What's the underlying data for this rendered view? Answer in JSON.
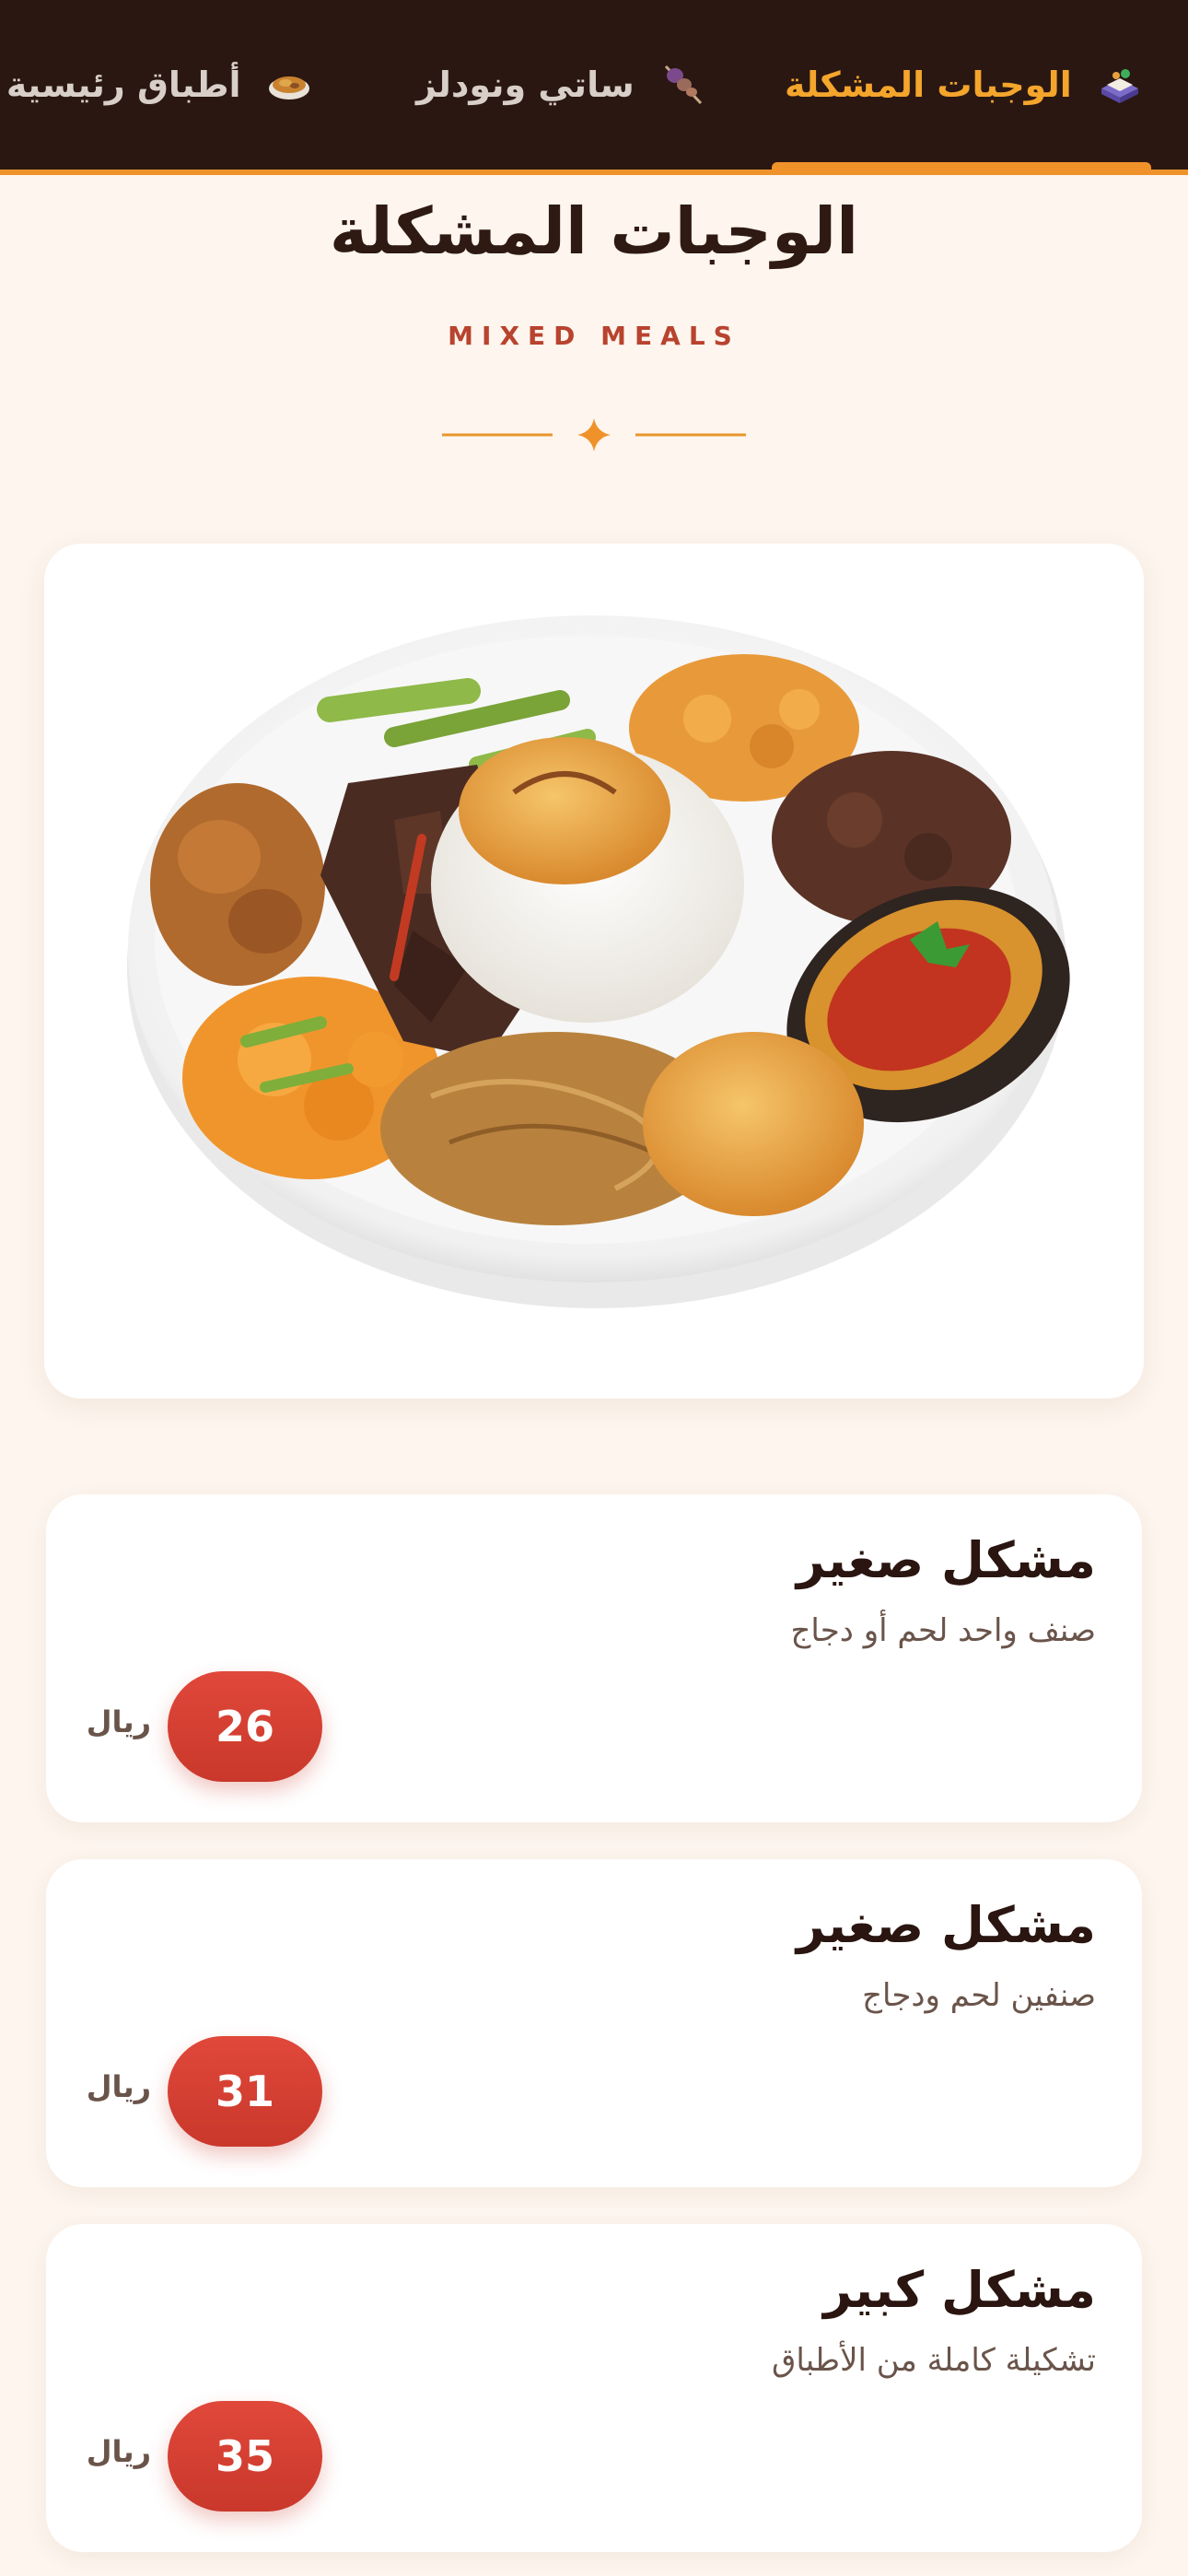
{
  "nav": {
    "tabs": [
      {
        "label": "الوجبات المشكلة",
        "icon": "mixed-meals-icon",
        "active": true
      },
      {
        "label": "ساتي ونودلز",
        "icon": "skewer-icon",
        "active": false
      },
      {
        "label": "أطباق رئيسية و",
        "icon": "main-dish-icon",
        "active": false
      }
    ]
  },
  "section": {
    "title": "الوجبات المشكلة",
    "subtitle": "MIXED MEALS",
    "ornament_icon": "sparkle-icon"
  },
  "hero": {
    "image": "mixed-meal-plate-image"
  },
  "items": [
    {
      "name": "مشكل صغير",
      "description": "صنف واحد لحم أو دجاج",
      "price": "26",
      "currency": "ريال"
    },
    {
      "name": "مشكل صغير",
      "description": "صنفين لحم ودجاج",
      "price": "31",
      "currency": "ريال"
    },
    {
      "name": "مشكل كبير",
      "description": "تشكيلة كاملة من الأطباق",
      "price": "35",
      "currency": "ريال"
    }
  ],
  "colors": {
    "nav_bg": "#2a1712",
    "accent_orange": "#f0922a",
    "active_tab_text": "#f4a52c",
    "price_red": "#d6402f",
    "page_bg": "#fdf5ee"
  }
}
